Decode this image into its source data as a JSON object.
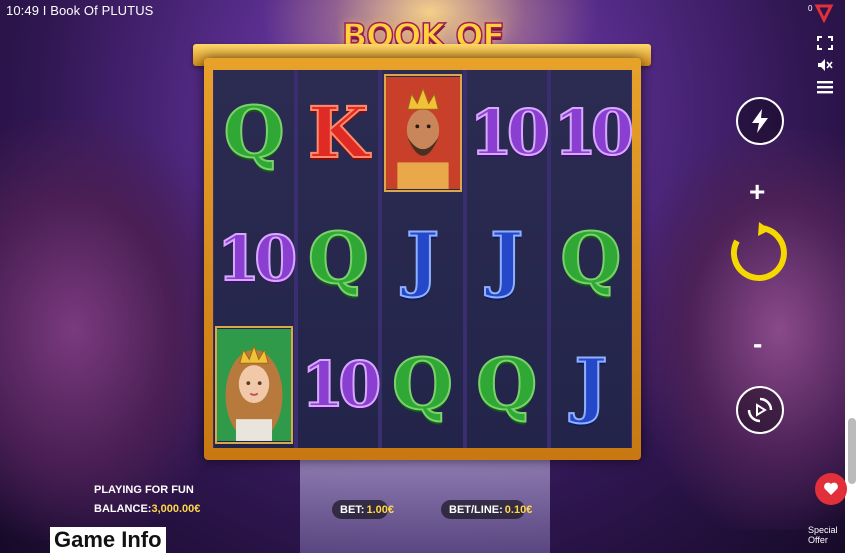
{
  "status_bar": {
    "time": "10:49",
    "title": "I Book Of PLUTUS",
    "corner_num": "0"
  },
  "logo_text": "BOOK OF PLUTUS",
  "reels": [
    [
      "Q",
      "10",
      "queen-portrait"
    ],
    [
      "K",
      "Q",
      "10"
    ],
    [
      "king-portrait",
      "J",
      "Q"
    ],
    [
      "10",
      "J",
      "Q"
    ],
    [
      "10",
      "Q",
      "J"
    ]
  ],
  "controls": {
    "plus": "+",
    "minus": "-"
  },
  "info": {
    "playing": "PLAYING FOR FUN",
    "balance_label": "BALANCE:",
    "balance_value": "3,000.00€",
    "bet_label": "BET:",
    "bet_value": "1.00€",
    "betline_label": "BET/LINE:",
    "betline_value": "0.10€"
  },
  "page": {
    "game_info": "Game Info",
    "special_offer": "Special Offer"
  },
  "colors": {
    "accent_gold": "#ffd84a",
    "spin_yellow": "#f5d800",
    "offer_red": "#e2303a"
  }
}
